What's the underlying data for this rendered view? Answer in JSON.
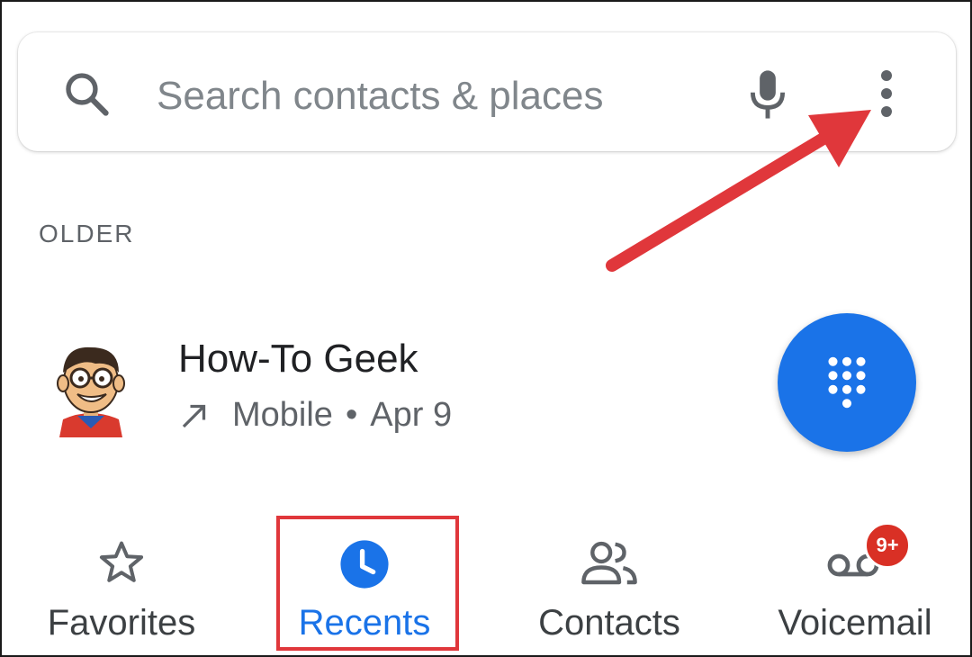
{
  "search": {
    "placeholder": "Search contacts & places"
  },
  "recents": {
    "section_header": "OLDER",
    "calls": [
      {
        "name": "How-To Geek",
        "call_type_icon": "outgoing-call-arrow-icon",
        "phone_type": "Mobile",
        "separator": "•",
        "date": "Apr 9"
      }
    ]
  },
  "fab": {
    "icon": "dialpad-icon"
  },
  "bottom_nav": {
    "items": [
      {
        "label": "Favorites",
        "icon": "star-icon",
        "selected": false
      },
      {
        "label": "Recents",
        "icon": "clock-icon",
        "selected": true
      },
      {
        "label": "Contacts",
        "icon": "people-icon",
        "selected": false
      },
      {
        "label": "Voicemail",
        "icon": "voicemail-icon",
        "selected": false,
        "badge": "9+"
      }
    ]
  },
  "colors": {
    "accent": "#1a73e8",
    "annotation_red": "#e0373b",
    "badge_red": "#d93025",
    "text_primary": "#202124",
    "text_secondary": "#5f6368"
  }
}
